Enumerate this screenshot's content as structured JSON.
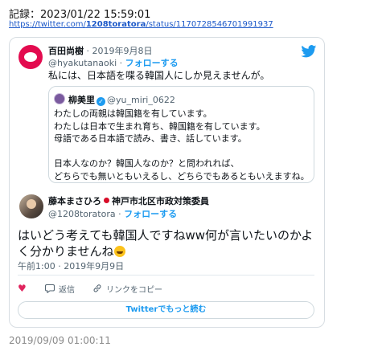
{
  "record": {
    "label": "記録：2023/01/22 15:59:01"
  },
  "url": {
    "prefix": "https://twitter.com/",
    "bold": "1208toratora",
    "suffix": "/status/1170728546701991937"
  },
  "quoted_tweet": {
    "name": "百田尚樹",
    "date": " · 2019年9月8日",
    "handle": "@hyakutanaoki",
    "follow": "フォローする",
    "text": "私には、日本語を喋る韓国人にしか見えませんが。",
    "inner": {
      "name": "柳美里",
      "handle": "@yu_miri_0622",
      "text": "わたしの両親は韓国籍を有しています。\nわたしは日本で生まれ育ち、韓国籍を有しています。\n母語である日本語で読み、書き、話しています。\n\n日本人なのか？韓国人なのか？と問われれば、\nどちらでも無いともいえるし、どちらでもあるともいえますね。"
    }
  },
  "main_tweet": {
    "name": "藤本まさひろ",
    "title": "神戸市北区市政対策委員",
    "handle": "@1208toratora",
    "follow": "フォローする",
    "text": "はいどう考えても韓国人ですねww何が言いたいのかよく分かりませんね",
    "time": "午前1:00 · 2019年9月9日"
  },
  "actions": {
    "reply": "返信",
    "copy_link": "リンクをコピー"
  },
  "cta": {
    "label": "Twitterでもっと読む"
  },
  "footer": {
    "timestamp": "2019/09/09 01:00:11"
  },
  "colors": {
    "accent": "#1d9bf0",
    "heart": "#e0245e",
    "logo": "#e30b4f",
    "link": "#1d59c9"
  },
  "icons": {
    "brand": "twitter-bird-icon",
    "like": "heart-icon",
    "reply": "reply-icon",
    "link": "link-icon"
  }
}
